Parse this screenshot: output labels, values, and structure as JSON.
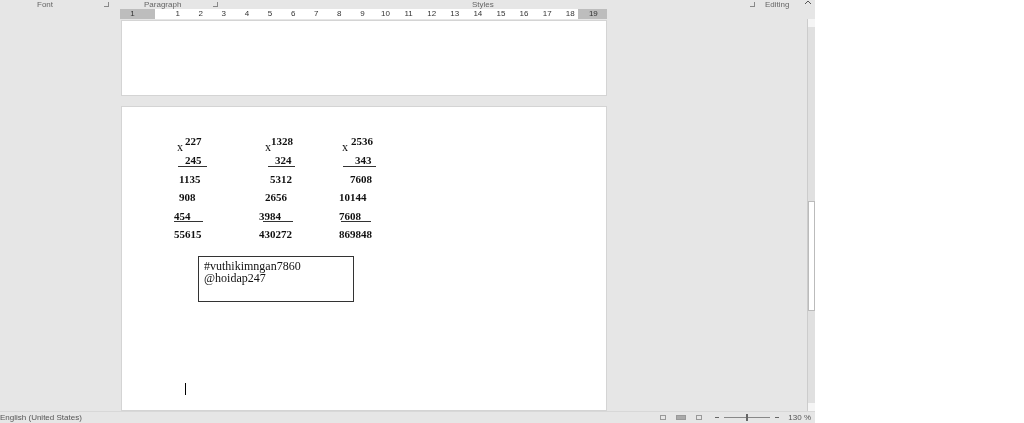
{
  "ribbon_groups": [
    {
      "label": "Font"
    },
    {
      "label": "Paragraph"
    },
    {
      "label": "Styles"
    },
    {
      "label": "Editing"
    }
  ],
  "ruler": {
    "labels": [
      "1",
      "1",
      "2",
      "3",
      "4",
      "5",
      "6",
      "7",
      "8",
      "9",
      "10",
      "11",
      "12",
      "13",
      "14",
      "15",
      "16",
      "17",
      "18",
      "19"
    ]
  },
  "problems": [
    {
      "sign": "x",
      "multiplicand": "227",
      "multiplier": "245",
      "partials": [
        "1135",
        "908",
        "454"
      ],
      "product": "55615"
    },
    {
      "sign": "x",
      "multiplicand": "1328",
      "multiplier": "324",
      "partials": [
        "5312",
        "2656",
        "3984"
      ],
      "product": "430272"
    },
    {
      "sign": "x",
      "multiplicand": "2536",
      "multiplier": "343",
      "partials": [
        "7608",
        "10144",
        "7608"
      ],
      "product": "869848"
    }
  ],
  "text_box": {
    "lines": [
      "#vuthikimngan7860",
      "@hoidap247"
    ]
  },
  "status_bar": {
    "language": "English (United States)",
    "zoom": {
      "level": 0.5,
      "reading": "130 %"
    }
  }
}
